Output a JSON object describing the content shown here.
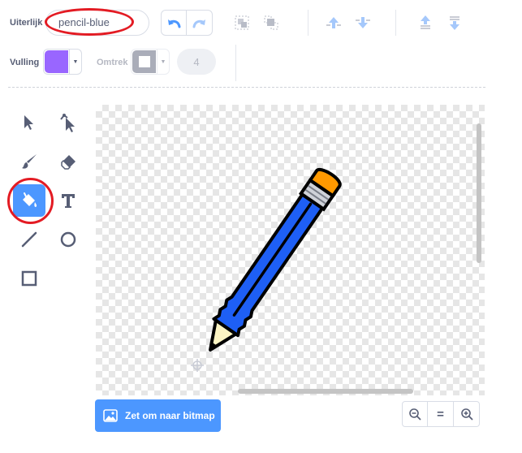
{
  "costume": {
    "label": "Uiterlijk",
    "name": "pencil-blue"
  },
  "fill": {
    "label": "Vulling",
    "color": "#9966ff"
  },
  "outline": {
    "label": "Omtrek",
    "width": "4"
  },
  "toolbar": {
    "undo_icon": "undo-icon",
    "redo_icon": "redo-icon",
    "group_icon": "group-icon",
    "ungroup_icon": "ungroup-icon",
    "forward_icon": "forward-icon",
    "backward_icon": "backward-icon",
    "front_icon": "front-icon",
    "back_icon": "back-icon"
  },
  "tools": [
    "select",
    "reshape",
    "brush",
    "eraser",
    "fill",
    "text",
    "line",
    "circle",
    "rectangle"
  ],
  "selected_tool": "fill",
  "convert_button": {
    "label": "Zet om naar bitmap"
  },
  "zoom": {
    "out": "zoom-out-icon",
    "reset": "=",
    "in": "zoom-in-icon"
  },
  "colors": {
    "accent": "#4c97ff",
    "highlight": "#e31b23",
    "pencil_body": "#1e5ff5",
    "pencil_eraser": "#ff9900"
  }
}
